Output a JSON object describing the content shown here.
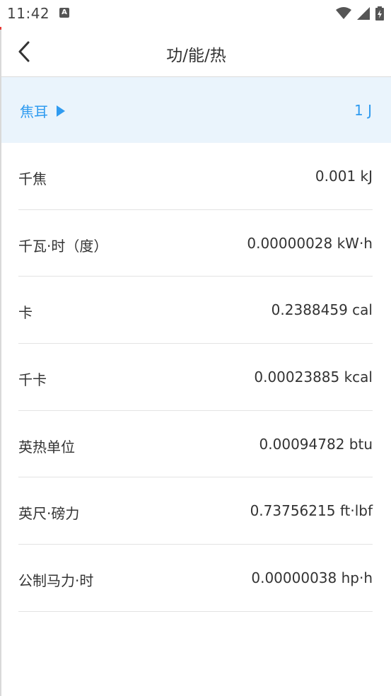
{
  "status": {
    "time": "11:42",
    "app_icon_letter": "A"
  },
  "header": {
    "title": "功/能/热",
    "back_icon": "chevron-left-icon"
  },
  "selected": {
    "unit": "焦耳",
    "value": "1 J",
    "indicator_icon": "triangle-right-icon",
    "accent": "#2f9bf0"
  },
  "units": [
    {
      "name": "千焦",
      "value": "0.001 kJ"
    },
    {
      "name": "千瓦·时（度）",
      "value": "0.00000028 kW·h"
    },
    {
      "name": "卡",
      "value": "0.2388459 cal"
    },
    {
      "name": "千卡",
      "value": "0.00023885 kcal"
    },
    {
      "name": "英热单位",
      "value": "0.00094782 btu"
    },
    {
      "name": "英尺·磅力",
      "value": "0.73756215 ft·lbf"
    },
    {
      "name": "公制马力·时",
      "value": "0.00000038 hp·h"
    }
  ]
}
